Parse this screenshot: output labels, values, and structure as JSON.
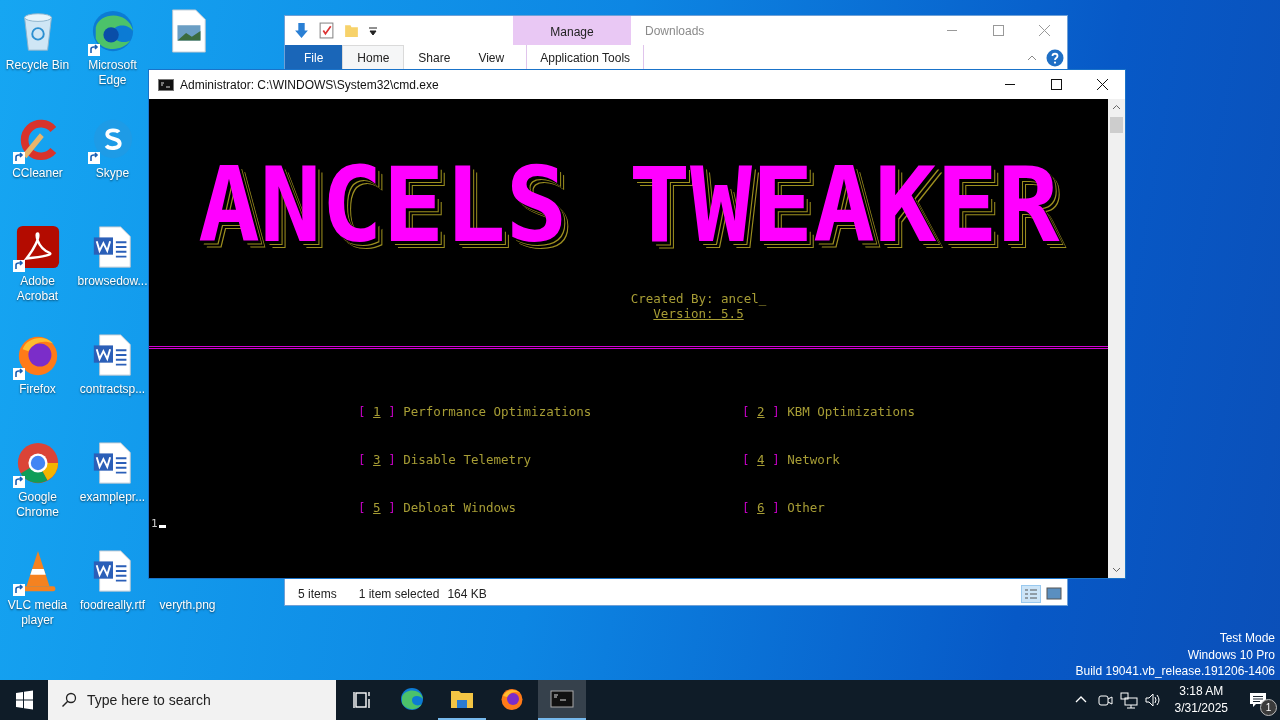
{
  "desktop_icons": [
    {
      "label": "Recycle Bin",
      "kind": "recycle",
      "shortcut": false
    },
    {
      "label": "CCleaner",
      "kind": "ccleaner",
      "shortcut": true
    },
    {
      "label": "Adobe Acrobat",
      "kind": "acrobat",
      "shortcut": true
    },
    {
      "label": "Firefox",
      "kind": "firefox",
      "shortcut": true
    },
    {
      "label": "Google Chrome",
      "kind": "chrome",
      "shortcut": true
    },
    {
      "label": "VLC media player",
      "kind": "vlc",
      "shortcut": true
    },
    {
      "label": "Microsoft Edge",
      "kind": "edge",
      "shortcut": true
    },
    {
      "label": "Skype",
      "kind": "skype",
      "shortcut": true
    },
    {
      "label": "browsedow...",
      "kind": "word",
      "shortcut": false
    },
    {
      "label": "contractsp...",
      "kind": "word",
      "shortcut": false
    },
    {
      "label": "examplepr...",
      "kind": "word",
      "shortcut": false
    },
    {
      "label": "foodreally.rtf",
      "kind": "word",
      "shortcut": false
    },
    {
      "kind": "image",
      "shortcut": false
    },
    {
      "label": "veryth.png",
      "kind": "hidden"
    }
  ],
  "explorer": {
    "title": "Downloads",
    "context_group": "Manage",
    "tabs": [
      {
        "label": "File",
        "kind": "file",
        "selected": false
      },
      {
        "label": "Home",
        "kind": "normal",
        "selected": true
      },
      {
        "label": "Share",
        "kind": "normal",
        "selected": false
      },
      {
        "label": "View",
        "kind": "normal",
        "selected": false
      },
      {
        "label": "Application Tools",
        "kind": "contextual",
        "selected": false
      }
    ],
    "status": {
      "items": "5 items",
      "selection": "1 item selected",
      "size": "164 KB"
    }
  },
  "cmd": {
    "title": "Administrator: C:\\WINDOWS\\System32\\cmd.exe",
    "banner": "ANCELS TWEAKER",
    "credit": "Created By: ancel_",
    "version": "Version: 5.5",
    "menu": [
      {
        "open": "[",
        "number": "1",
        "close": "]",
        "label": "Performance Optimizations"
      },
      {
        "open": "[",
        "number": "2",
        "close": "]",
        "label": "KBM Optimizations"
      },
      {
        "open": "[",
        "number": "3",
        "close": "]",
        "label": "Disable Telemetry"
      },
      {
        "open": "[",
        "number": "4",
        "close": "]",
        "label": "Network"
      },
      {
        "open": "[",
        "number": "5",
        "close": "]",
        "label": "Debloat Windows"
      },
      {
        "open": "[",
        "number": "6",
        "close": "]",
        "label": "Other"
      }
    ],
    "input": "1"
  },
  "system_info": [
    "Test Mode",
    "Windows 10 Pro",
    "Build 19041.vb_release.191206-1406"
  ],
  "taskbar": {
    "search_placeholder": "Type here to search",
    "apps": [
      {
        "kind": "edge",
        "running": false,
        "selected": false
      },
      {
        "kind": "folder",
        "running": true,
        "selected": false
      },
      {
        "kind": "firefox",
        "running": false,
        "selected": false
      },
      {
        "kind": "terminal",
        "running": true,
        "selected": true
      }
    ],
    "time": "3:18 AM",
    "date": "3/31/2025",
    "notifications": "1"
  }
}
